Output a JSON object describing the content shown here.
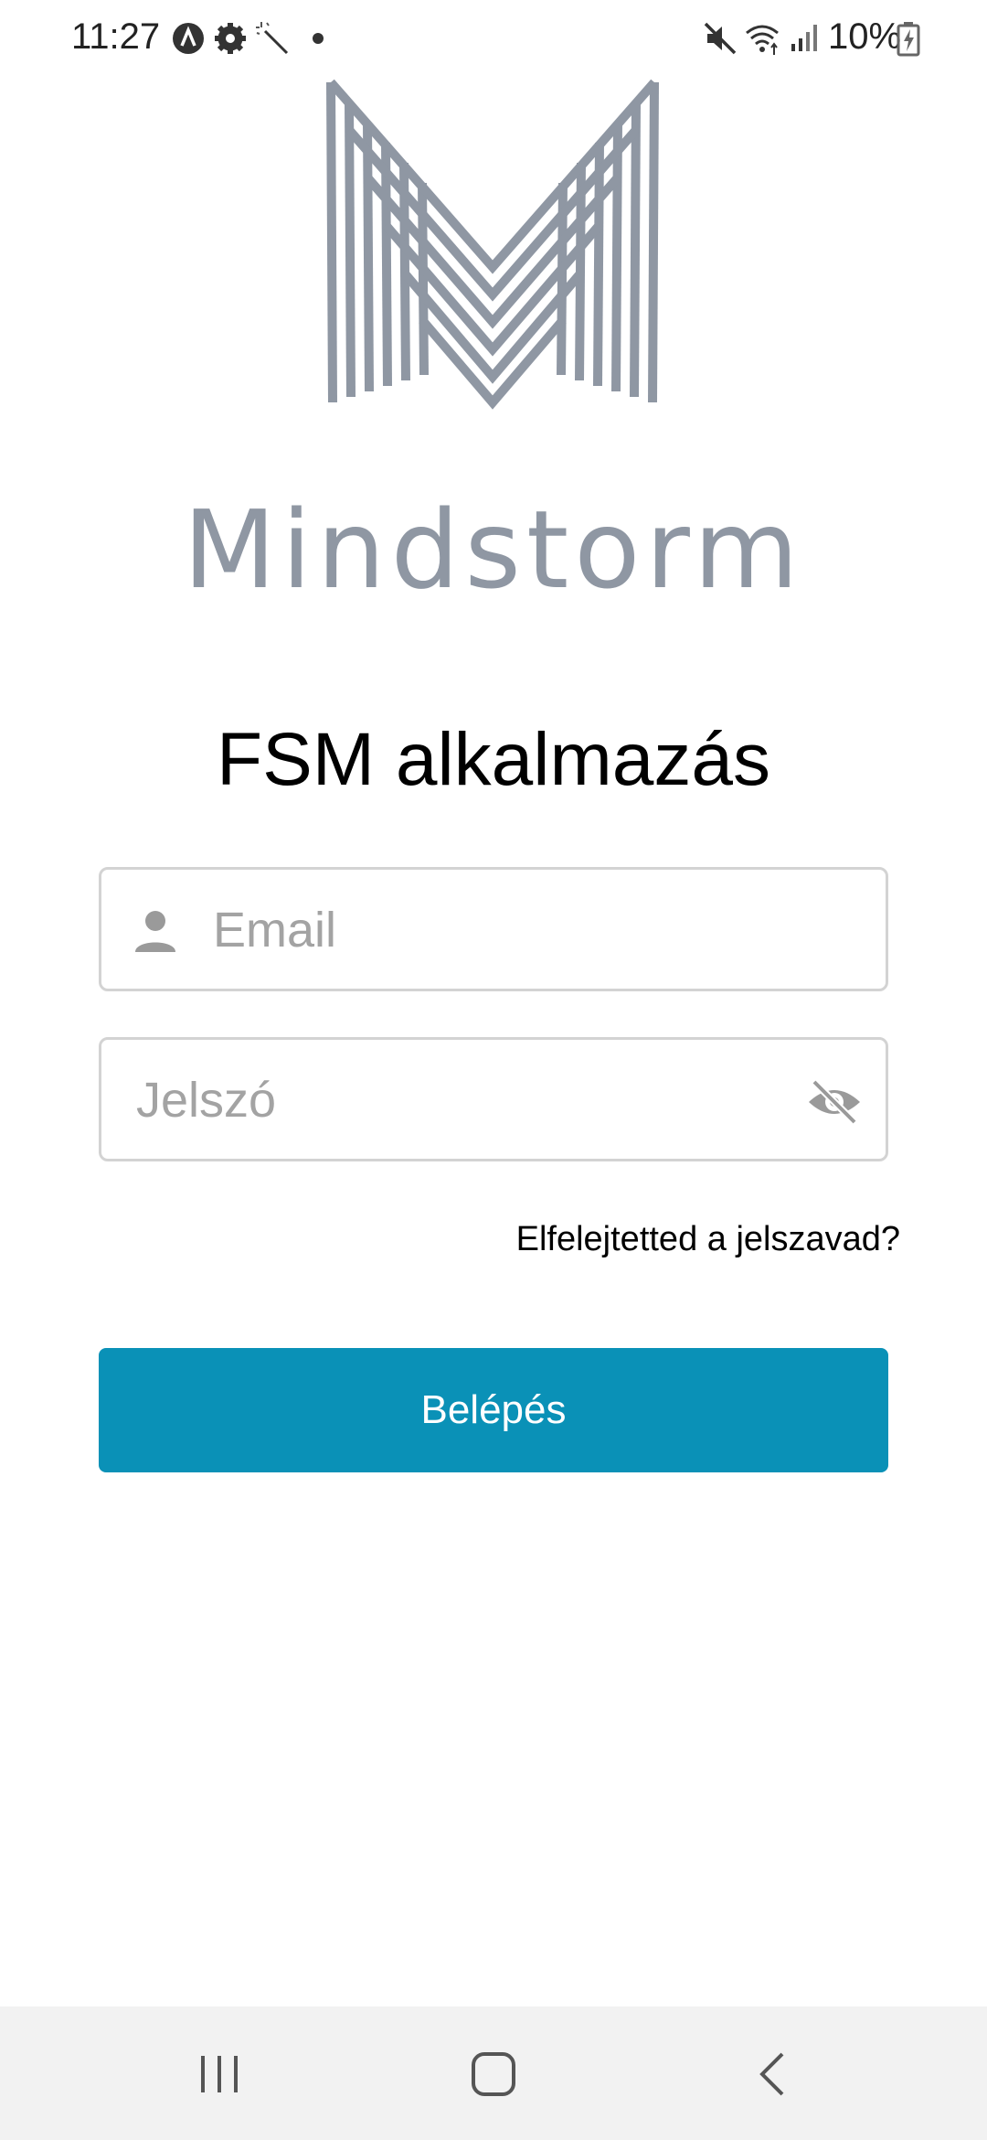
{
  "status_bar": {
    "time": "11:27",
    "battery_percent": "10%",
    "icons": [
      "a-badge-icon",
      "gear-icon",
      "magic-wand-icon",
      "dot-icon",
      "mute-icon",
      "wifi-icon",
      "signal-icon",
      "battery-charging-icon"
    ]
  },
  "brand": {
    "logo_icon": "mindstorm-m-logo",
    "name": "Mindstorm",
    "logo_color": "#8f97a3"
  },
  "login": {
    "title": "FSM alkalmazás",
    "email_placeholder": "Email",
    "email_value": "",
    "password_placeholder": "Jelszó",
    "password_value": "",
    "forgot_password": "Elfelejtetted a jelszavad?",
    "submit_label": "Belépés",
    "accent_color": "#0a91b7"
  },
  "nav_bar": {
    "icons": [
      "recent-apps-icon",
      "home-icon",
      "back-icon"
    ]
  }
}
